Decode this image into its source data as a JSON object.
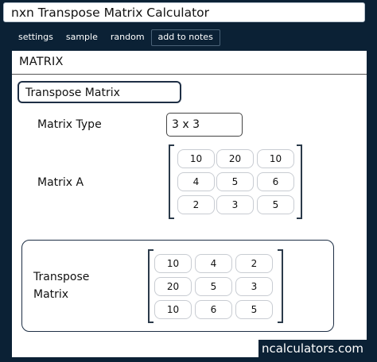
{
  "title": "nxn Transpose Matrix Calculator",
  "menu": [
    "settings",
    "sample",
    "random",
    "add to notes"
  ],
  "panel": {
    "header": "MATRIX",
    "section_title": "Transpose Matrix",
    "matrix_type_label": "Matrix Type",
    "matrix_type_value": "3 x 3",
    "matrix_a_label": "Matrix A",
    "matrix_a": [
      [
        "10",
        "20",
        "10"
      ],
      [
        "4",
        "5",
        "6"
      ],
      [
        "2",
        "3",
        "5"
      ]
    ],
    "transpose_label_line1": "Transpose",
    "transpose_label_line2": "Matrix",
    "transpose": [
      [
        "10",
        "4",
        "2"
      ],
      [
        "20",
        "5",
        "3"
      ],
      [
        "10",
        "6",
        "5"
      ]
    ]
  },
  "footer": "ncalculators.com"
}
